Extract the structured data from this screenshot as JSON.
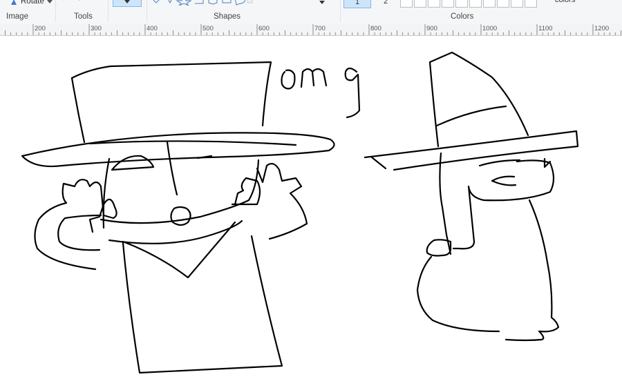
{
  "ribbon": {
    "groups": {
      "image_label": "Image",
      "tools_label": "Tools",
      "shapes_label": "Shapes",
      "colors_label": "Colors"
    },
    "rotate_label": "Rotate",
    "color1_label": "1",
    "color2_label": "2",
    "edit_colors_label": "colors"
  },
  "ruler": {
    "ticks": [
      "200",
      "300",
      "400",
      "500",
      "600",
      "700",
      "800",
      "900",
      "1000",
      "1100",
      "1200"
    ]
  },
  "canvas": {
    "handwritten_text": "omg"
  }
}
